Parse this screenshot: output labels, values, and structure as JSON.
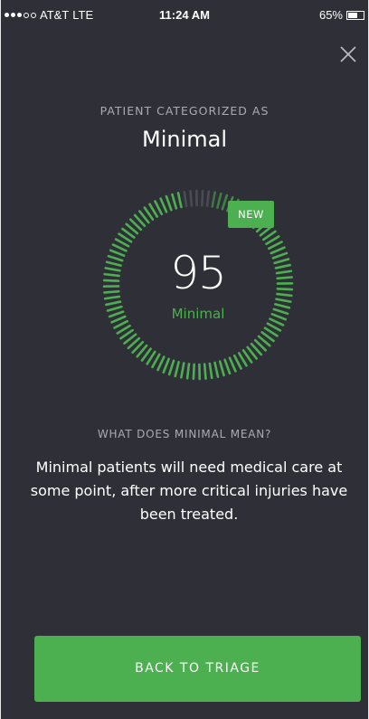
{
  "status_bar": {
    "carrier": "AT&T",
    "network": "LTE",
    "time": "11:24 AM",
    "battery": "65%",
    "battery_level": 0.65,
    "signal_bars_filled": 3,
    "signal_bars_total": 5
  },
  "close_icon": "close-icon",
  "category": {
    "label": "PATIENT CATEGORIZED AS",
    "title": "Minimal"
  },
  "gauge": {
    "score": "95",
    "score_value": 95,
    "score_max": 100,
    "status": "Minimal",
    "badge": "NEW",
    "active_color": "#4caf50",
    "inactive_color": "#4a4c53"
  },
  "meaning": {
    "label": "WHAT DOES MINIMAL MEAN?",
    "text": "Minimal patients will need medical care at some point, after more critical injuries have been treated."
  },
  "footer": {
    "button_label": "BACK TO TRIAGE"
  },
  "colors": {
    "background": "#2f3037",
    "accent": "#4caf50",
    "muted_text": "#a9aab3"
  }
}
